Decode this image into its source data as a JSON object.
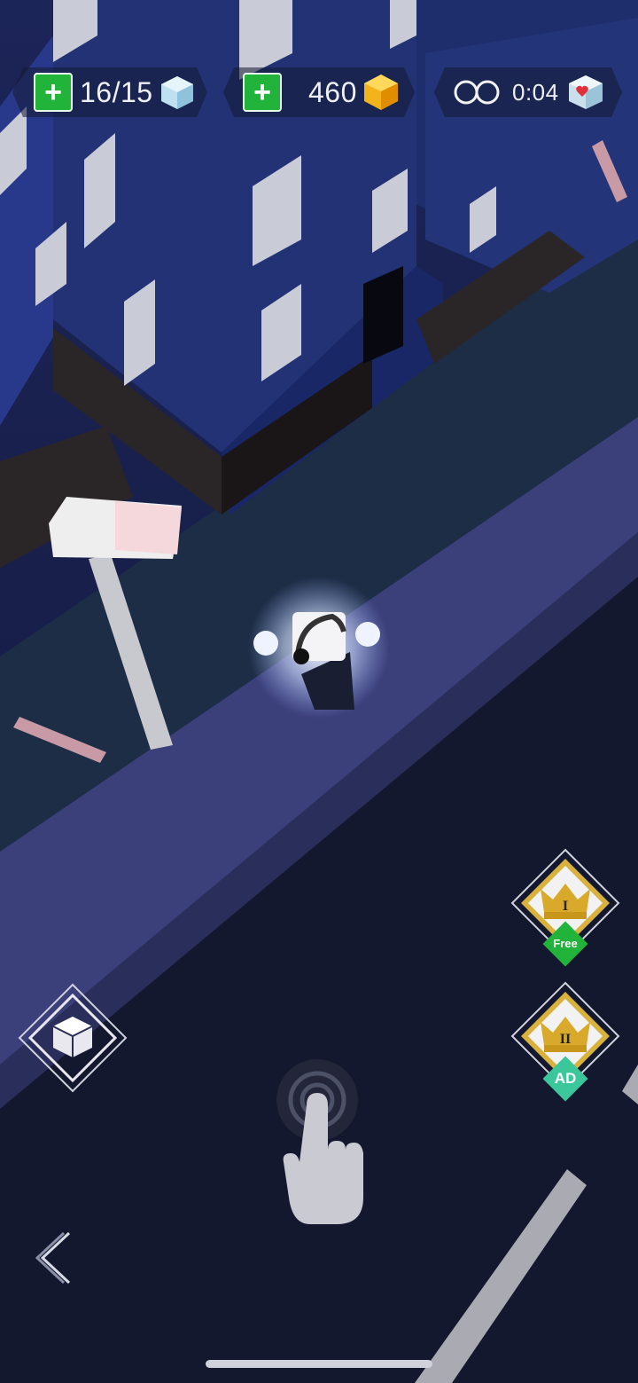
{
  "hud": {
    "lives_count": "16/15",
    "gems_count": "460",
    "timer": "0:04"
  },
  "buttons": {
    "crown_free_badge": "Free",
    "crown_ad_badge": "AD"
  },
  "colors": {
    "plus_green": "#22b33a",
    "gem_gold": "#f3b31b",
    "crown_gold": "#d8b23c",
    "sky": "#1a2150"
  },
  "icons": [
    "plus-icon",
    "ice-cube-icon",
    "gold-gem-icon",
    "infinity-icon",
    "heart-cube-icon",
    "crown-1-icon",
    "crown-2-icon",
    "cube-view-icon",
    "tap-hand-icon",
    "back-arrow-icon"
  ]
}
